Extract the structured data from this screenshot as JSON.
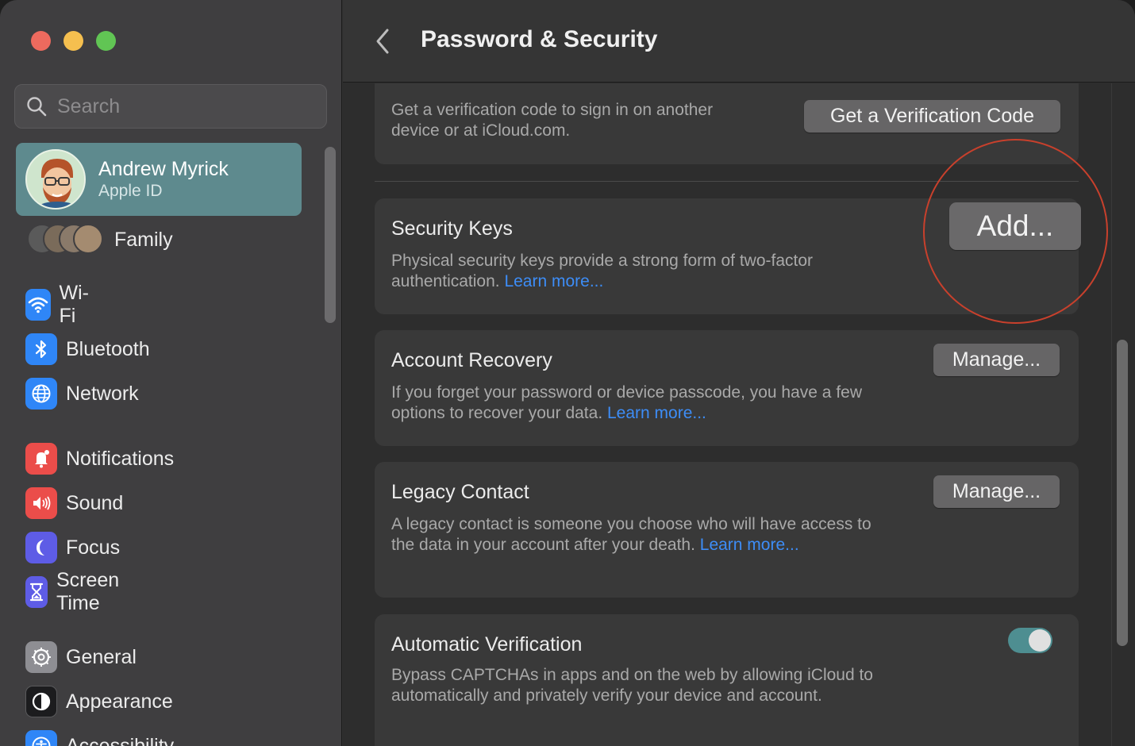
{
  "window": {
    "controls": {
      "close_color": "#ed6a5e",
      "minimize_color": "#f5bf4f",
      "zoom_color": "#61c554"
    }
  },
  "sidebar": {
    "search": {
      "placeholder": "Search",
      "value": ""
    },
    "account": {
      "name": "Andrew Myrick",
      "subtitle": "Apple ID",
      "selected": true,
      "highlight_color": "#5e8a8e"
    },
    "family": {
      "label": "Family"
    },
    "items": [
      {
        "label": "Wi-Fi",
        "icon": "wifi-icon",
        "color": "#2f86f7"
      },
      {
        "label": "Bluetooth",
        "icon": "bluetooth-icon",
        "color": "#2f86f7"
      },
      {
        "label": "Network",
        "icon": "globe-icon",
        "color": "#2f86f7"
      },
      {
        "label": "Notifications",
        "icon": "bell-icon",
        "color": "#eb4d4a"
      },
      {
        "label": "Sound",
        "icon": "speaker-icon",
        "color": "#eb4d4a"
      },
      {
        "label": "Focus",
        "icon": "moon-icon",
        "color": "#5e5ce6"
      },
      {
        "label": "Screen Time",
        "icon": "hourglass-icon",
        "color": "#5e5ce6"
      },
      {
        "label": "General",
        "icon": "gear-icon",
        "color": "#8e8e93"
      },
      {
        "label": "Appearance",
        "icon": "appearance-icon",
        "color": "#1c1c1e"
      },
      {
        "label": "Accessibility",
        "icon": "accessibility-icon",
        "color": "#2f86f7"
      }
    ]
  },
  "main": {
    "title": "Password & Security",
    "sections": {
      "verification_code": {
        "description": "Get a verification code to sign in on another device or at iCloud.com.",
        "button": "Get a Verification Code"
      },
      "security_keys": {
        "heading": "Security Keys",
        "description": "Physical security keys provide a strong form of two-factor authentication.",
        "link": "Learn more...",
        "button": "Add..."
      },
      "account_recovery": {
        "heading": "Account Recovery",
        "description": "If you forget your password or device passcode, you have a few options to recover your data.",
        "link": "Learn more...",
        "button": "Manage..."
      },
      "legacy_contact": {
        "heading": "Legacy Contact",
        "description": "A legacy contact is someone you choose who will have access to the data in your account after your death.",
        "link": "Learn more...",
        "button": "Manage..."
      },
      "automatic_verification": {
        "heading": "Automatic Verification",
        "description": "Bypass CAPTCHAs in apps and on the web by allowing iCloud to automatically and privately verify your device and account.",
        "toggle_on": true
      }
    },
    "annotation_color": "#c8402c",
    "link_color": "#3d8df7"
  }
}
